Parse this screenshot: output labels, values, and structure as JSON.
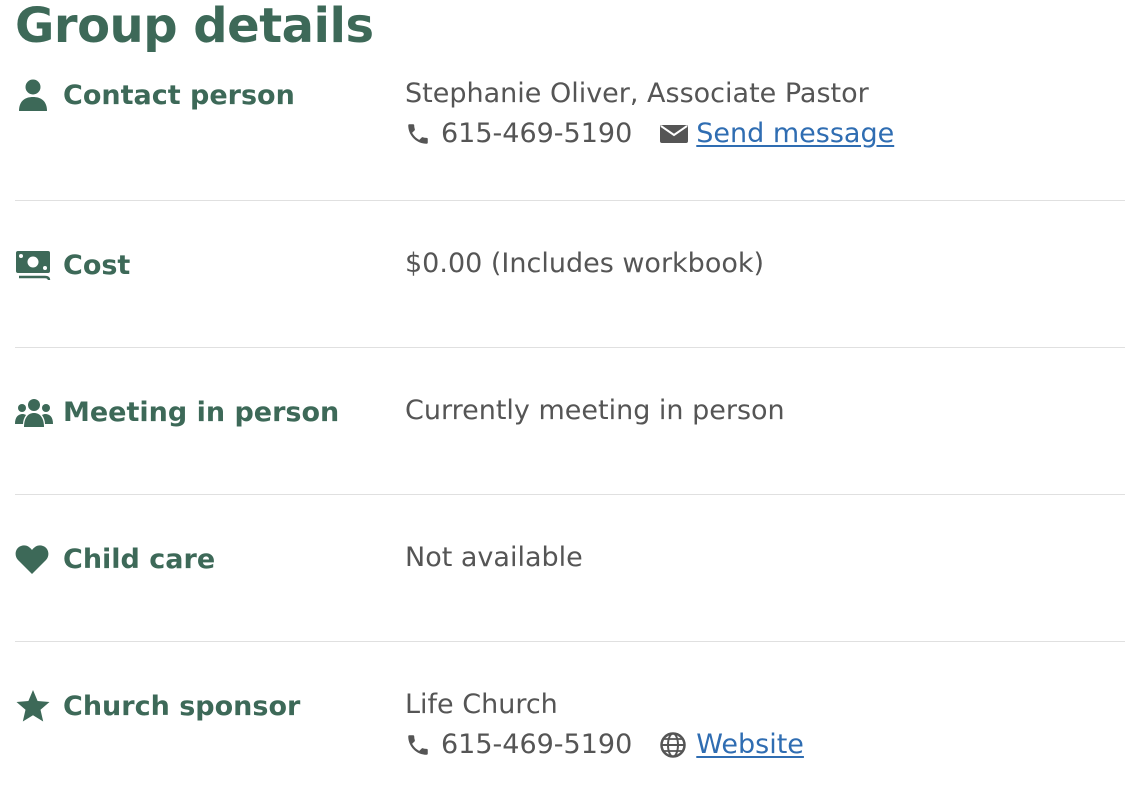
{
  "title": "Group details",
  "contact": {
    "label": "Contact person",
    "name": "Stephanie Oliver, Associate Pastor",
    "phone": "615-469-5190",
    "message_link": "Send message"
  },
  "cost": {
    "label": "Cost",
    "value": "$0.00 (Includes workbook)"
  },
  "meeting": {
    "label": "Meeting in person",
    "value": "Currently meeting in person"
  },
  "childcare": {
    "label": "Child care",
    "value": "Not available"
  },
  "sponsor": {
    "label": "Church sponsor",
    "name": "Life Church",
    "phone": "615-469-5190",
    "website_link": "Website"
  },
  "colors": {
    "heading": "#3d6958",
    "text": "#555555",
    "link": "#2f6db2",
    "divider": "#e0e0e0"
  },
  "icons": [
    "person-icon",
    "phone-icon",
    "envelope-icon",
    "money-icon",
    "users-icon",
    "heart-icon",
    "star-icon",
    "globe-icon"
  ]
}
